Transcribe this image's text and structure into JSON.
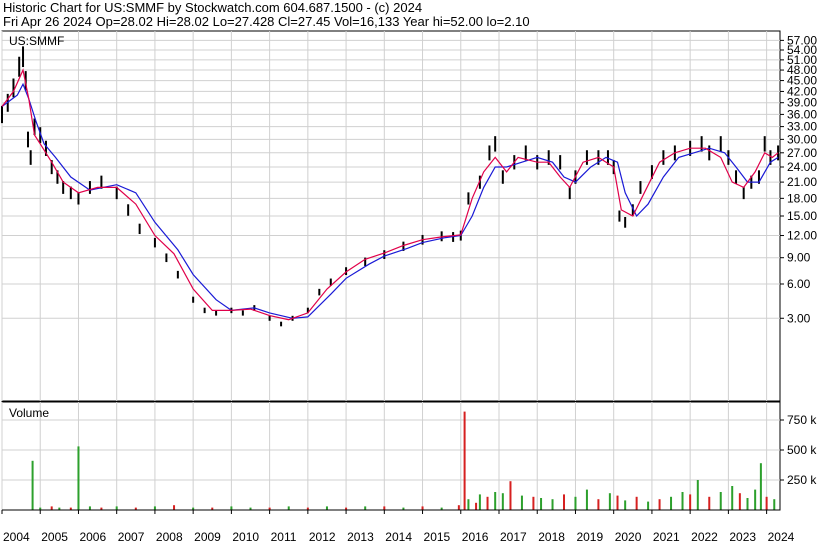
{
  "header": {
    "line1": "Historic Chart for US:SMMF by Stockwatch.com 604.687.1500 - (c) 2024",
    "line2": "Fri Apr 26 2024   Op=28.02  Hi=28.02  Lo=27.428  Cl=27.45  Vol=16,133  Year hi=52.00  lo=2.10"
  },
  "colors": {
    "price_bar": "#000000",
    "ma_short": "#e0004a",
    "ma_long": "#1a1ad6",
    "vol_up": "#2ca02c",
    "vol_down": "#d62020",
    "grid": "#d0d0d0"
  },
  "chart_data": [
    {
      "type": "line",
      "title": "US:SMMF",
      "y_scale": "sqrt",
      "ylim": [
        0,
        60
      ],
      "y_ticks": [
        "57.00",
        "54.00",
        "51.00",
        "48.00",
        "45.00",
        "42.00",
        "39.00",
        "36.00",
        "33.00",
        "30.00",
        "27.00",
        "24.00",
        "21.00",
        "18.00",
        "15.00",
        "12.00",
        "9.00",
        "6.00",
        "3.00"
      ],
      "x_ticks": [
        "2004",
        "2005",
        "2006",
        "2007",
        "2008",
        "2009",
        "2010",
        "2011",
        "2012",
        "2013",
        "2014",
        "2015",
        "2016",
        "2017",
        "2018",
        "2019",
        "2020",
        "2021",
        "2022",
        "2023",
        "2024"
      ],
      "xlim": [
        2004.0,
        2024.35
      ],
      "grid": true,
      "series": [
        {
          "style": "price-bars",
          "x": [
            2004.0,
            2004.15,
            2004.3,
            2004.45,
            2004.55,
            2004.62,
            2004.68,
            2004.75,
            2004.85,
            2005.0,
            2005.15,
            2005.3,
            2005.45,
            2005.6,
            2005.8,
            2006.0,
            2006.3,
            2006.6,
            2007.0,
            2007.3,
            2007.6,
            2008.0,
            2008.3,
            2008.6,
            2009.0,
            2009.3,
            2009.6,
            2010.0,
            2010.3,
            2010.6,
            2011.0,
            2011.3,
            2011.6,
            2012.0,
            2012.3,
            2012.6,
            2013.0,
            2013.5,
            2014.0,
            2014.5,
            2015.0,
            2015.5,
            2015.8,
            2016.0,
            2016.2,
            2016.5,
            2016.75,
            2016.9,
            2017.1,
            2017.4,
            2017.7,
            2018.0,
            2018.3,
            2018.6,
            2018.85,
            2019.0,
            2019.3,
            2019.6,
            2019.85,
            2020.0,
            2020.15,
            2020.3,
            2020.5,
            2020.7,
            2021.0,
            2021.3,
            2021.6,
            2022.0,
            2022.3,
            2022.5,
            2022.8,
            2023.0,
            2023.2,
            2023.4,
            2023.6,
            2023.8,
            2023.95,
            2024.1,
            2024.3
          ],
          "y": [
            36,
            39,
            43,
            49,
            52,
            45,
            30,
            26,
            33,
            31,
            28,
            24,
            22,
            20,
            19,
            18,
            20,
            21,
            19,
            16,
            13,
            11,
            9,
            7,
            4.5,
            3.6,
            3.4,
            3.6,
            3.4,
            3.8,
            3.0,
            2.6,
            3.0,
            3.6,
            5.2,
            6.2,
            7.4,
            8.5,
            9.4,
            10.5,
            11.4,
            11.9,
            11.8,
            12.0,
            18,
            21,
            27,
            29,
            22,
            25,
            27,
            25,
            26,
            25,
            19,
            22,
            26,
            26,
            26,
            24,
            15,
            14,
            16,
            20,
            23,
            26,
            27,
            28,
            29,
            27,
            29,
            26,
            22,
            19,
            21,
            22,
            29,
            26,
            27
          ]
        },
        {
          "name": "",
          "style": "moving-average-short",
          "x": [
            2004.0,
            2004.3,
            2004.55,
            2004.7,
            2004.85,
            2005.0,
            2005.3,
            2005.6,
            2006.0,
            2006.5,
            2007.0,
            2007.5,
            2008.0,
            2008.5,
            2009.0,
            2009.5,
            2010.0,
            2010.5,
            2011.0,
            2011.5,
            2012.0,
            2012.5,
            2013.0,
            2013.5,
            2014.0,
            2014.5,
            2015.0,
            2015.5,
            2016.0,
            2016.3,
            2016.6,
            2016.9,
            2017.2,
            2017.5,
            2018.0,
            2018.3,
            2018.6,
            2018.85,
            2019.2,
            2019.6,
            2020.0,
            2020.2,
            2020.5,
            2020.8,
            2021.2,
            2021.6,
            2022.0,
            2022.4,
            2022.8,
            2023.1,
            2023.4,
            2023.7,
            2023.95,
            2024.15,
            2024.3
          ],
          "y": [
            38,
            42,
            48,
            40,
            31,
            29,
            25,
            21,
            19,
            20,
            20,
            17,
            12,
            9.5,
            5.5,
            3.6,
            3.6,
            3.7,
            3.2,
            2.9,
            3.4,
            5.5,
            7.3,
            8.8,
            9.6,
            10.6,
            11.4,
            11.8,
            12.1,
            18,
            23,
            26,
            23,
            26,
            25,
            25,
            22,
            20,
            25,
            26,
            24,
            16,
            15,
            19,
            25,
            27,
            28,
            28,
            26,
            21,
            20,
            23,
            27,
            26,
            27
          ]
        },
        {
          "name": "",
          "style": "moving-average-long",
          "x": [
            2004.0,
            2004.4,
            2004.55,
            2004.7,
            2004.9,
            2005.1,
            2005.4,
            2005.8,
            2006.3,
            2007.0,
            2007.5,
            2008.0,
            2008.6,
            2009.0,
            2009.6,
            2010.0,
            2010.6,
            2011.0,
            2011.6,
            2012.0,
            2012.6,
            2013.0,
            2013.6,
            2014.0,
            2014.6,
            2015.0,
            2015.6,
            2016.0,
            2016.3,
            2016.6,
            2016.9,
            2017.2,
            2017.6,
            2018.0,
            2018.4,
            2018.7,
            2019.0,
            2019.4,
            2019.8,
            2020.1,
            2020.3,
            2020.6,
            2020.9,
            2021.3,
            2021.7,
            2022.1,
            2022.5,
            2022.9,
            2023.2,
            2023.5,
            2023.8,
            2024.1,
            2024.3
          ],
          "y": [
            38,
            41,
            44,
            40,
            34,
            29,
            26,
            22,
            19.5,
            20.5,
            19,
            14,
            10,
            7,
            4.5,
            3.6,
            3.8,
            3.4,
            3.0,
            3.1,
            5.0,
            6.6,
            8.2,
            9.2,
            10.2,
            11.0,
            11.7,
            12.0,
            15,
            20,
            24,
            24,
            25,
            26,
            25,
            22,
            21,
            24,
            26,
            25,
            19,
            15,
            17,
            22,
            26,
            27,
            28,
            27,
            24,
            21,
            21,
            25,
            26
          ]
        }
      ]
    },
    {
      "type": "bar",
      "title": "Volume",
      "y_ticks": [
        "750 k",
        "500 k",
        "250 k"
      ],
      "ylim": [
        0,
        900000
      ],
      "grid": true,
      "x": [
        2004.8,
        2005.0,
        2005.3,
        2005.5,
        2005.8,
        2006.0,
        2006.3,
        2006.6,
        2007.0,
        2007.5,
        2008.0,
        2008.5,
        2009.0,
        2009.5,
        2010.0,
        2010.5,
        2011.0,
        2011.5,
        2012.0,
        2012.5,
        2013.0,
        2013.5,
        2014.0,
        2014.5,
        2015.0,
        2015.5,
        2015.95,
        2016.1,
        2016.2,
        2016.4,
        2016.5,
        2016.7,
        2016.9,
        2017.1,
        2017.3,
        2017.6,
        2017.9,
        2018.1,
        2018.4,
        2018.7,
        2019.0,
        2019.3,
        2019.6,
        2019.9,
        2020.1,
        2020.3,
        2020.6,
        2020.9,
        2021.2,
        2021.5,
        2021.8,
        2022.0,
        2022.2,
        2022.5,
        2022.8,
        2023.1,
        2023.3,
        2023.5,
        2023.7,
        2023.85,
        2024.0,
        2024.2
      ],
      "values": [
        410000,
        20000,
        30000,
        20000,
        20000,
        530000,
        30000,
        20000,
        30000,
        20000,
        30000,
        40000,
        20000,
        20000,
        30000,
        20000,
        20000,
        30000,
        20000,
        30000,
        20000,
        30000,
        30000,
        20000,
        30000,
        20000,
        40000,
        820000,
        90000,
        60000,
        130000,
        110000,
        150000,
        140000,
        240000,
        120000,
        110000,
        100000,
        90000,
        130000,
        110000,
        170000,
        90000,
        140000,
        120000,
        80000,
        110000,
        70000,
        90000,
        110000,
        150000,
        130000,
        250000,
        110000,
        150000,
        200000,
        140000,
        100000,
        170000,
        390000,
        110000,
        90000
      ],
      "direction": [
        "up",
        "up",
        "down",
        "up",
        "down",
        "up",
        "up",
        "down",
        "up",
        "down",
        "up",
        "down",
        "up",
        "down",
        "up",
        "up",
        "down",
        "up",
        "down",
        "up",
        "down",
        "up",
        "down",
        "up",
        "down",
        "up",
        "down",
        "down",
        "up",
        "down",
        "up",
        "down",
        "up",
        "up",
        "down",
        "up",
        "down",
        "up",
        "up",
        "down",
        "up",
        "up",
        "down",
        "up",
        "down",
        "up",
        "down",
        "up",
        "down",
        "up",
        "up",
        "down",
        "up",
        "down",
        "up",
        "up",
        "down",
        "up",
        "up",
        "up",
        "down",
        "up"
      ]
    }
  ]
}
